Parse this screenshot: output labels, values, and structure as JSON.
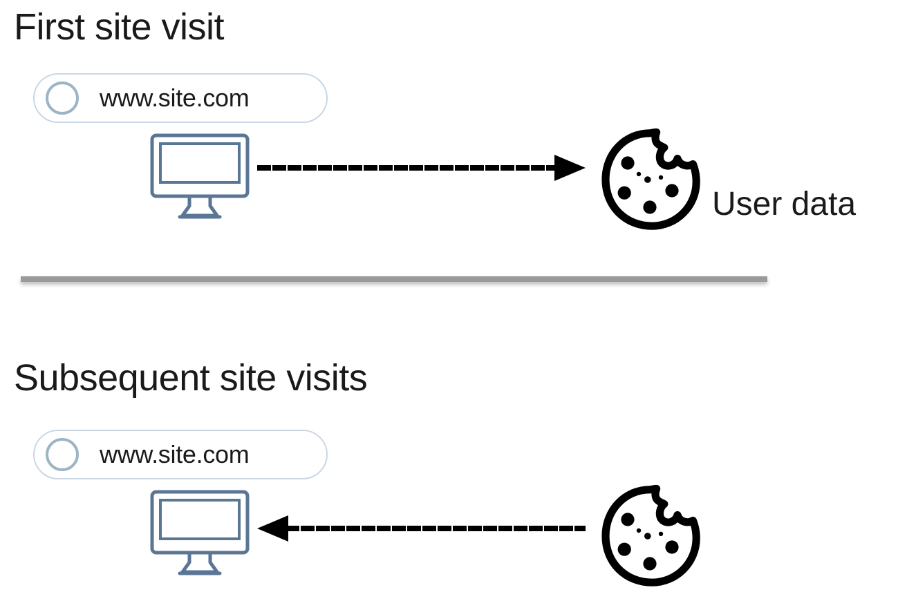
{
  "diagram": {
    "top": {
      "heading": "First site visit",
      "url": "www.site.com",
      "cookie_label": "User data",
      "arrow_direction": "right"
    },
    "bottom": {
      "heading": "Subsequent site visits",
      "url": "www.site.com",
      "arrow_direction": "left"
    }
  }
}
